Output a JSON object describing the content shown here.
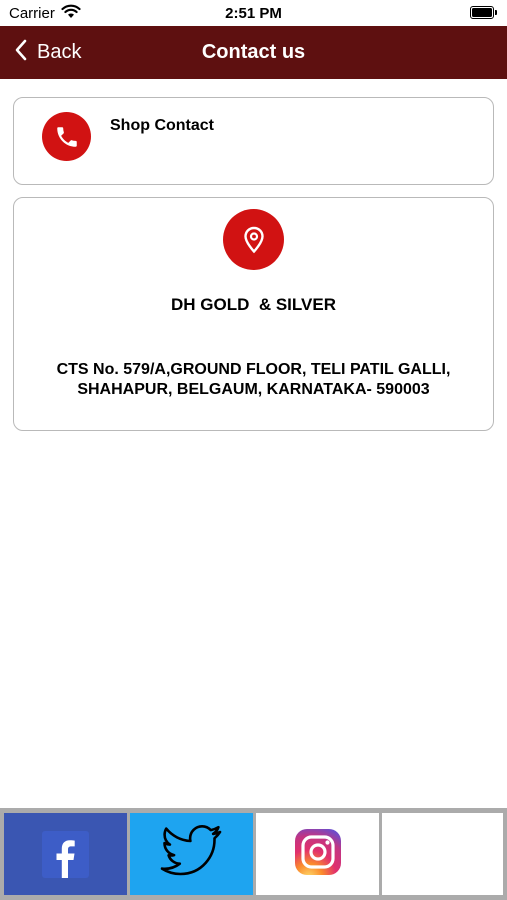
{
  "status_bar": {
    "carrier": "Carrier",
    "time": "2:51 PM"
  },
  "nav": {
    "back_label": "Back",
    "title": "Contact us",
    "background_color": "#5e1010"
  },
  "shop_contact": {
    "label": "Shop Contact",
    "icon": "phone-icon",
    "icon_color": "#d11212"
  },
  "address_card": {
    "icon": "location-pin-icon",
    "store_name": "DH GOLD  & SILVER",
    "address_line_1": "CTS No. 579/A,GROUND FLOOR, TELI PATIL GALLI,",
    "address_line_2": "SHAHAPUR, BELGAUM, KARNATAKA- 590003"
  },
  "social": {
    "buttons": [
      {
        "icon": "facebook-icon",
        "color": "#3a56b2"
      },
      {
        "icon": "twitter-icon",
        "color": "#1ea4f0"
      },
      {
        "icon": "instagram-icon",
        "color": "#ffffff"
      }
    ]
  }
}
